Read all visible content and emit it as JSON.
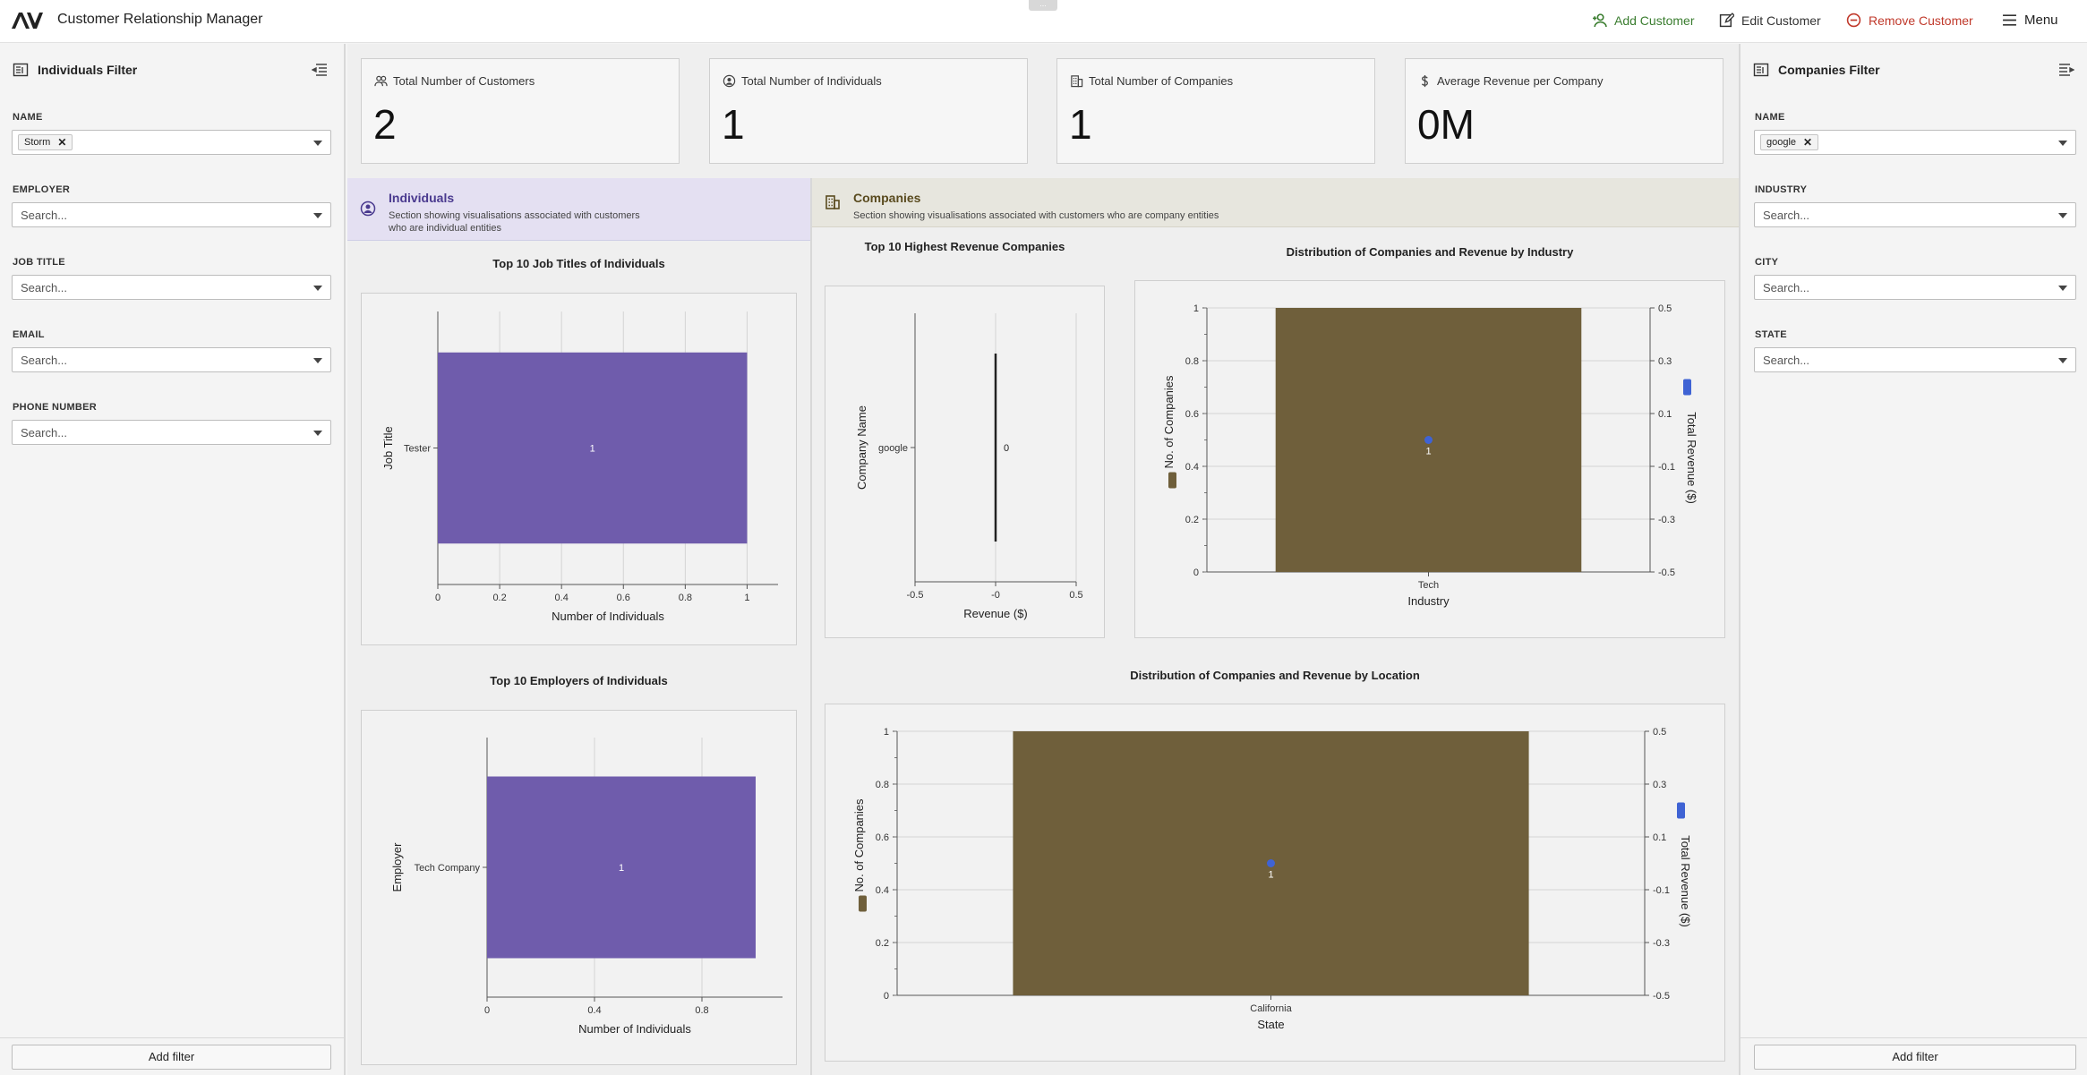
{
  "header": {
    "title": "Customer Relationship Manager",
    "drag_handle": "...",
    "add_customer": "Add Customer",
    "edit_customer": "Edit Customer",
    "remove_customer": "Remove Customer",
    "menu": "Menu"
  },
  "left_panel": {
    "title": "Individuals Filter",
    "filters": [
      {
        "label": "NAME",
        "chip": "Storm"
      },
      {
        "label": "EMPLOYER",
        "placeholder": "Search..."
      },
      {
        "label": "JOB TITLE",
        "placeholder": "Search..."
      },
      {
        "label": "EMAIL",
        "placeholder": "Search..."
      },
      {
        "label": "PHONE NUMBER",
        "placeholder": "Search..."
      }
    ],
    "add_filter": "Add filter"
  },
  "right_panel": {
    "title": "Companies Filter",
    "filters": [
      {
        "label": "NAME",
        "chip": "google"
      },
      {
        "label": "INDUSTRY",
        "placeholder": "Search..."
      },
      {
        "label": "CITY",
        "placeholder": "Search..."
      },
      {
        "label": "STATE",
        "placeholder": "Search..."
      }
    ],
    "add_filter": "Add filter"
  },
  "kpis": [
    {
      "label": "Total Number of Customers",
      "value": "2"
    },
    {
      "label": "Total Number of Individuals",
      "value": "1"
    },
    {
      "label": "Total Number of Companies",
      "value": "1"
    },
    {
      "label": "Average Revenue per Company",
      "value": "0M"
    }
  ],
  "sections": {
    "individuals": {
      "title": "Individuals",
      "desc": "Section showing visualisations associated with customers who are individual entities"
    },
    "companies": {
      "title": "Companies",
      "desc": "Section showing visualisations associated with customers who are company entities"
    }
  },
  "colors": {
    "individuals_bar": "#6f5cac",
    "companies_bar": "#6f5f3b",
    "revenue_point": "#3f63d4",
    "header_green": "#3a7d2f",
    "remove_red": "#c0392b"
  },
  "chart_data": [
    {
      "id": "job_titles",
      "type": "bar",
      "orientation": "horizontal",
      "title": "Top 10 Job Titles of Individuals",
      "categories": [
        "Tester"
      ],
      "values": [
        1
      ],
      "xlabel": "Number of Individuals",
      "ylabel": "Job Title",
      "xlim": [
        0,
        1.1
      ],
      "xticks": [
        "0",
        "0.2",
        "0.4",
        "0.6",
        "0.8",
        "1"
      ],
      "data_labels": [
        "1"
      ]
    },
    {
      "id": "employers",
      "type": "bar",
      "orientation": "horizontal",
      "title": "Top 10 Employers of Individuals",
      "categories": [
        "Tech Company"
      ],
      "values": [
        1
      ],
      "xlabel": "Number of Individuals",
      "ylabel": "Employer",
      "xlim": [
        0,
        1.1
      ],
      "xticks": [
        "0",
        "0.4",
        "0.8"
      ],
      "data_labels": [
        "1"
      ]
    },
    {
      "id": "revenue_companies",
      "type": "bar",
      "orientation": "horizontal",
      "title": "Top 10 Highest Revenue Companies",
      "categories": [
        "google"
      ],
      "values": [
        0
      ],
      "xlabel": "Revenue ($)",
      "ylabel": "Company Name",
      "xlim": [
        -0.5,
        0.5
      ],
      "xticks": [
        "-0.5",
        "-0",
        "0.5"
      ],
      "data_labels": [
        "0"
      ]
    },
    {
      "id": "by_industry",
      "type": "bar",
      "title": "Distribution of Companies and Revenue by Industry",
      "categories": [
        "Tech"
      ],
      "series": [
        {
          "name": "No. of Companies",
          "values": [
            1
          ],
          "axis": "left"
        },
        {
          "name": "Total Revenue ($)",
          "values": [
            0
          ],
          "axis": "right",
          "style": "point"
        }
      ],
      "xlabel": "Industry",
      "ylabel": "No. of Companies",
      "y2label": "Total Revenue ($)",
      "ylim": [
        0,
        1
      ],
      "y2lim": [
        -0.5,
        0.5
      ],
      "yticks": [
        "0",
        "0.2",
        "0.4",
        "0.6",
        "0.8",
        "1"
      ],
      "y2ticks": [
        "-0.5",
        "-0.3",
        "-0.1",
        "0.1",
        "0.3",
        "0.5"
      ],
      "data_labels": [
        "1"
      ]
    },
    {
      "id": "by_location",
      "type": "bar",
      "title": "Distribution of Companies and Revenue by Location",
      "categories": [
        "California"
      ],
      "series": [
        {
          "name": "No. of Companies",
          "values": [
            1
          ],
          "axis": "left"
        },
        {
          "name": "Total Revenue ($)",
          "values": [
            0
          ],
          "axis": "right",
          "style": "point"
        }
      ],
      "xlabel": "State",
      "ylabel": "No. of Companies",
      "y2label": "Total Revenue ($)",
      "ylim": [
        0,
        1
      ],
      "y2lim": [
        -0.5,
        0.5
      ],
      "yticks": [
        "0",
        "0.2",
        "0.4",
        "0.6",
        "0.8",
        "1"
      ],
      "y2ticks": [
        "-0.5",
        "-0.3",
        "-0.1",
        "0.1",
        "0.3",
        "0.5"
      ],
      "data_labels": [
        "1"
      ]
    }
  ]
}
